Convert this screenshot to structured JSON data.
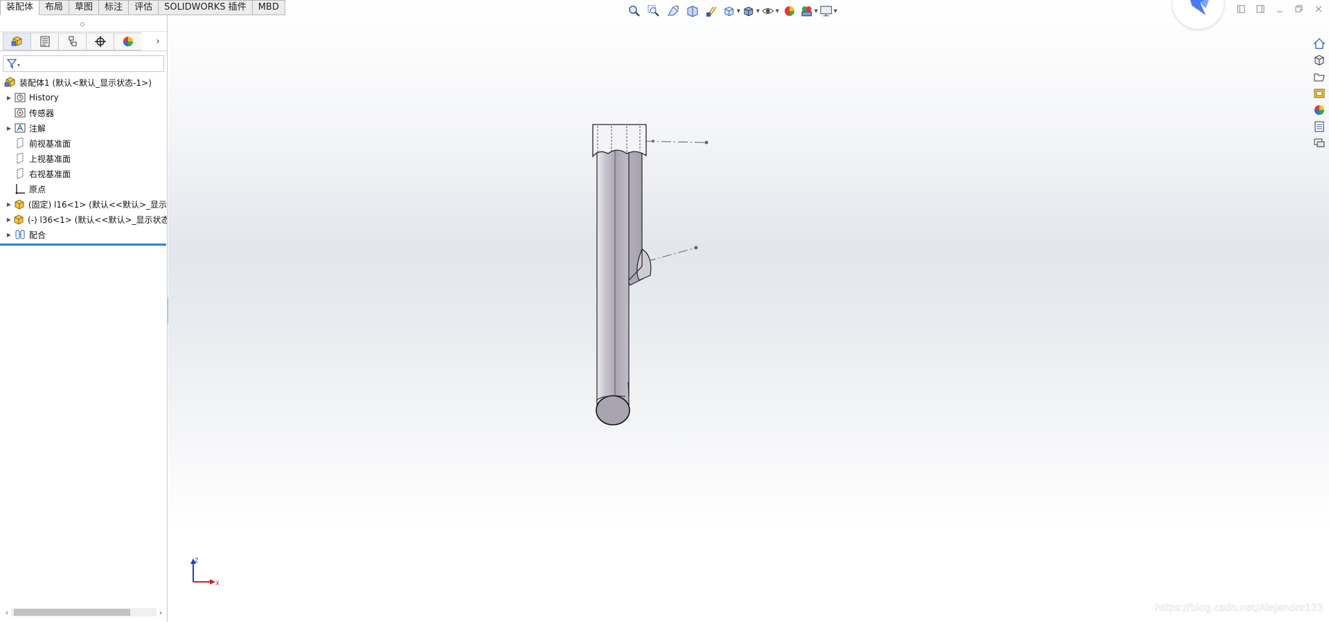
{
  "command_tabs": [
    "装配体",
    "布局",
    "草图",
    "标注",
    "评估",
    "SOLIDWORKS 插件",
    "MBD"
  ],
  "active_tab": "装配体",
  "manager_tabs": [
    "featuremanager-icon",
    "propertymanager-icon",
    "configurationmanager-icon",
    "dimxpertmanager-icon",
    "displaymanager-icon"
  ],
  "feature_tree": {
    "root": "装配体1 (默认<默认_显示状态-1>)",
    "items": [
      {
        "label": "History",
        "icon": "history-icon",
        "expandable": true
      },
      {
        "label": "传感器",
        "icon": "sensor-icon",
        "expandable": false
      },
      {
        "label": "注解",
        "icon": "annotation-icon",
        "expandable": true
      },
      {
        "label": "前视基准面",
        "icon": "plane-icon",
        "expandable": false
      },
      {
        "label": "上视基准面",
        "icon": "plane-icon",
        "expandable": false
      },
      {
        "label": "右视基准面",
        "icon": "plane-icon",
        "expandable": false
      },
      {
        "label": "原点",
        "icon": "origin-icon",
        "expandable": false
      },
      {
        "label": "(固定) l16<1> (默认<<默认>_显示",
        "icon": "part-icon",
        "expandable": true
      },
      {
        "label": "(-) l36<1> (默认<<默认>_显示状态",
        "icon": "part-icon",
        "expandable": true
      },
      {
        "label": "配合",
        "icon": "mates-icon",
        "expandable": true
      }
    ]
  },
  "triad": {
    "z": "Z",
    "x": "X"
  },
  "watermark": "https://blog.csdn.net/Alejandro123",
  "colors": {
    "accent": "#2e7fd1",
    "part_fill": "#b4b0bb",
    "axis_x": "#d42020",
    "axis_z": "#2040c0"
  }
}
